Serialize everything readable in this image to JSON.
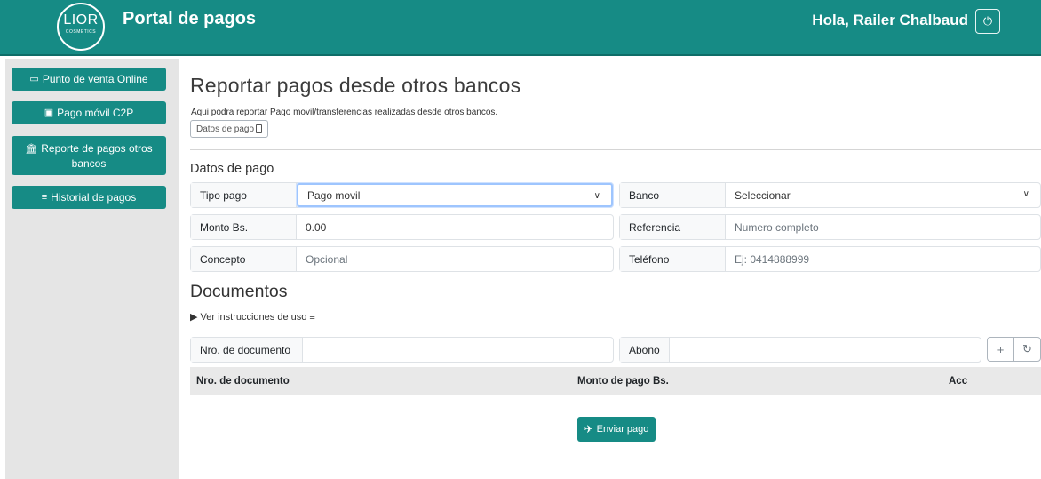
{
  "header": {
    "logo_text": "LIOR",
    "logo_sub": "COSMETICS",
    "title": "Portal de pagos",
    "greeting": "Hola, Railer Chalbaud",
    "power_icon": "⏻"
  },
  "sidebar": {
    "items": [
      {
        "icon": "▭",
        "label": "Punto de venta Online"
      },
      {
        "icon": "▣",
        "label": "Pago móvil C2P"
      },
      {
        "icon": "🏛",
        "label": "Reporte de pagos otros bancos"
      },
      {
        "icon": "≡",
        "label": "Historial de pagos"
      }
    ]
  },
  "main": {
    "title": "Reportar pagos desde otros bancos",
    "subtitle": "Aqui podra reportar Pago movil/transferencias realizadas desde otros bancos.",
    "datos_button": "Datos de pago",
    "section_title": "Datos de pago",
    "form": {
      "tipo_pago": {
        "label": "Tipo pago",
        "value": "Pago movil"
      },
      "banco": {
        "label": "Banco",
        "value": "Seleccionar"
      },
      "monto": {
        "label": "Monto Bs.",
        "value": "0.00"
      },
      "referencia": {
        "label": "Referencia",
        "placeholder": "Numero completo"
      },
      "concepto": {
        "label": "Concepto",
        "placeholder": "Opcional"
      },
      "telefono": {
        "label": "Teléfono",
        "placeholder": "Ej: 0414888999"
      }
    },
    "documentos": {
      "title": "Documentos",
      "instructions": "▶ Ver instrucciones de uso ≡",
      "nro_label": "Nro. de documento",
      "abono_label": "Abono",
      "add_icon": "+",
      "reset_icon": "↻"
    },
    "table": {
      "columns": [
        "Nro. de documento",
        "Monto de pago Bs.",
        "Acc"
      ]
    },
    "send_button": "Enviar pago"
  },
  "colors": {
    "primary": "#168b85",
    "sidebar_bg": "#e5e5e5"
  }
}
